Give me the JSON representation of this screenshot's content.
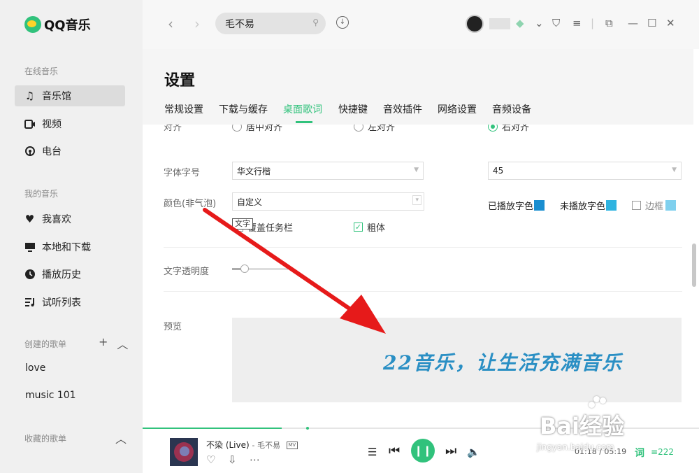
{
  "sidebar": {
    "logo_text": "QQ音乐",
    "sec_online": "在线音乐",
    "online_items": [
      {
        "label": "音乐馆",
        "icon": "music-note-icon"
      },
      {
        "label": "视频",
        "icon": "video-icon"
      },
      {
        "label": "电台",
        "icon": "radio-icon"
      }
    ],
    "sec_mine": "我的音乐",
    "mine_items": [
      {
        "label": "我喜欢",
        "icon": "heart-icon"
      },
      {
        "label": "本地和下载",
        "icon": "monitor-icon"
      },
      {
        "label": "播放历史",
        "icon": "clock-icon"
      },
      {
        "label": "试听列表",
        "icon": "playlist-icon"
      }
    ],
    "sec_created": "创建的歌单",
    "playlists": [
      "love",
      "music 101"
    ],
    "sec_collected": "收藏的歌单"
  },
  "topbar": {
    "search_value": "毛不易"
  },
  "settings": {
    "title": "设置",
    "tabs": [
      "常规设置",
      "下载与缓存",
      "桌面歌词",
      "快捷键",
      "音效插件",
      "网络设置",
      "音频设备"
    ],
    "active_tab": 2,
    "align_label": "对齐",
    "align_options": [
      "居中对齐",
      "左对齐",
      "右对齐"
    ],
    "align_checked": 2,
    "font_label": "字体字号",
    "font_value": "华文行楷",
    "size_value": "45",
    "color_label": "颜色(非气泡)",
    "color_value": "自定义",
    "played_color_label": "已播放字色",
    "unplayed_color_label": "未播放字色",
    "border_label": "边框",
    "colors": {
      "played": "#1a8ed0",
      "unplayed": "#2eb3e0",
      "border": "#7fd0ee",
      "accent": "#31c27c"
    },
    "cover_taskbar_label": "覆盖任务栏",
    "bold_label": "粗体",
    "bold_checked": true,
    "tooltip": "文字",
    "opacity_label": "文字透明度",
    "opacity_level": 0.22,
    "preview_label": "预览",
    "preview_text": "22音乐，让生活充满音乐"
  },
  "player": {
    "song_title": "不染 (Live)",
    "artist": "毛不易",
    "mv_label": "MV",
    "time": "01:18 / 05:19",
    "progress": 0.25,
    "lyric_label": "词",
    "queue_count": "222"
  },
  "watermark": {
    "logo": "Bai经验",
    "url": "jingyan.baidu.com"
  }
}
